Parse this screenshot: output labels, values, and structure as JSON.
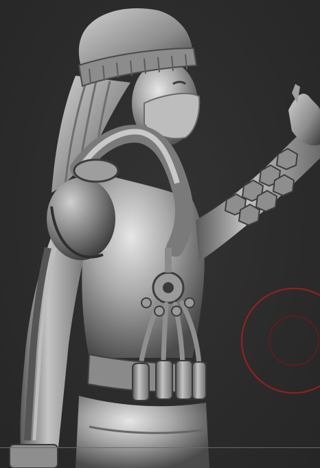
{
  "app": {
    "viewport_label": ""
  },
  "colors": {
    "background": "#2e2e2e",
    "model_base": "#9a9a9a",
    "model_highlight": "#d8d8d8",
    "model_shadow": "#3a3a3a",
    "brush_cursor": "#9b1f1f"
  },
  "icons": {
    "brush_cursor": "brush-cursor-icon"
  }
}
